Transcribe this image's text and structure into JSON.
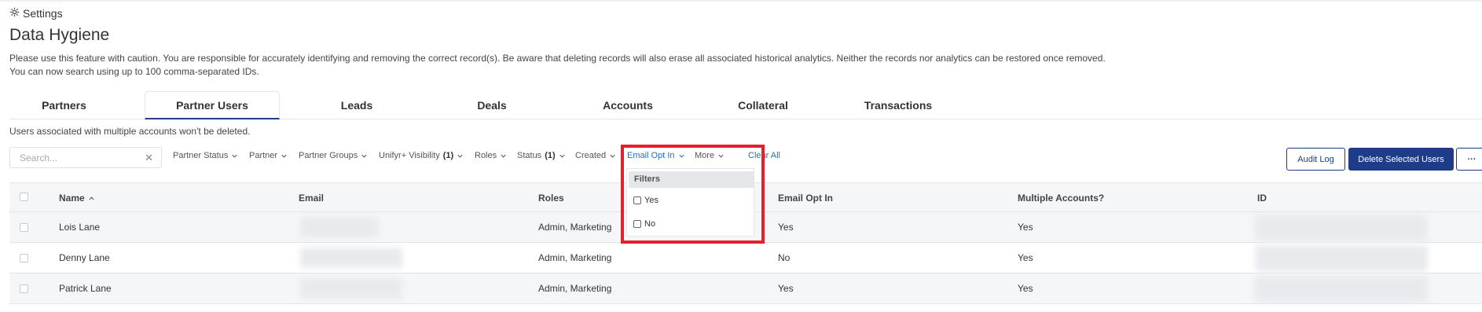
{
  "header": {
    "settings_label": "Settings",
    "title": "Data Hygiene",
    "description_line1": "Please use this feature with caution. You are responsible for accurately identifying and removing the correct record(s). Be aware that deleting records will also erase all associated historical analytics. Neither the records nor analytics can be restored once removed.",
    "description_line2": "You can now search using up to 100 comma-separated IDs."
  },
  "tabs": [
    {
      "label": "Partners"
    },
    {
      "label": "Partner Users",
      "active": true
    },
    {
      "label": "Leads"
    },
    {
      "label": "Deals"
    },
    {
      "label": "Accounts"
    },
    {
      "label": "Collateral"
    },
    {
      "label": "Transactions"
    }
  ],
  "note": "Users associated with multiple accounts won't be deleted.",
  "search": {
    "placeholder": "Search...",
    "value": ""
  },
  "filters": {
    "partner_status": "Partner Status",
    "partner": "Partner",
    "partner_groups": "Partner Groups",
    "unifyr_visibility": "Unifyr+ Visibility",
    "unifyr_visibility_count": "(1)",
    "roles": "Roles",
    "status": "Status",
    "status_count": "(1)",
    "created": "Created",
    "email_opt_in": "Email Opt In",
    "more": "More",
    "clear_all": "Clear All"
  },
  "dropdown": {
    "header": "Filters",
    "options": [
      {
        "label": "Yes",
        "checked": false
      },
      {
        "label": "No",
        "checked": false
      }
    ]
  },
  "buttons": {
    "audit_log": "Audit Log",
    "delete_selected": "Delete Selected Users",
    "more": "···"
  },
  "table": {
    "columns": {
      "name": "Name",
      "email": "Email",
      "roles": "Roles",
      "email_opt_in": "Email Opt In",
      "multiple_accounts": "Multiple Accounts?",
      "id": "ID"
    },
    "rows": [
      {
        "name": "Lois Lane",
        "roles": "Admin, Marketing",
        "email_opt_in": "Yes",
        "multiple_accounts": "Yes"
      },
      {
        "name": "Denny Lane",
        "roles": "Admin, Marketing",
        "email_opt_in": "No",
        "multiple_accounts": "Yes"
      },
      {
        "name": "Patrick Lane",
        "roles": "Admin, Marketing",
        "email_opt_in": "Yes",
        "multiple_accounts": "Yes"
      }
    ]
  },
  "colors": {
    "primary": "#1f3c88",
    "link": "#1f6fbf",
    "highlight": "#e3202b"
  }
}
